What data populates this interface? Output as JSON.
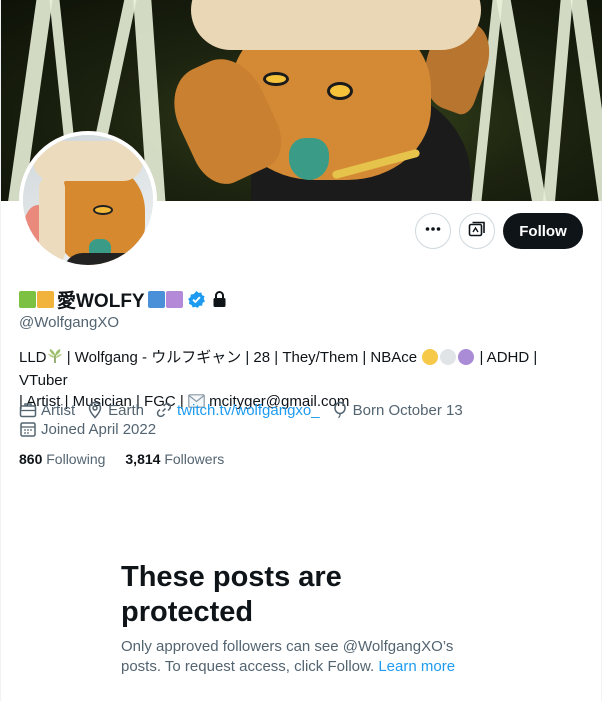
{
  "profile": {
    "display_name": "愛WOLFY",
    "handle": "@WolfgangXO",
    "bio_line1_a": "LLD",
    "bio_line1_b": " | Wolfgang - ウルフギャン | 28 | They/Them | NBAce ",
    "bio_line1_c": " | ADHD | VTuber",
    "bio_line2_a": "| Artist | Musician | FGC | ",
    "bio_line2_b": " mcityger@gmail.com",
    "name_emoji_left_colors": [
      "#7cc142",
      "#f2b33d"
    ],
    "name_emoji_right_colors": [
      "#4a90d9",
      "#b48ad8"
    ],
    "nbace_dot_colors": [
      "#f7c948",
      "#e1e4e6",
      "#a98bd6"
    ]
  },
  "meta": {
    "profession": "Artist",
    "location": "Earth",
    "website": "twitch.tv/wolfgangxo_",
    "born": "Born October 13",
    "joined": "Joined April 2022"
  },
  "stats": {
    "following_count": "860",
    "following_label": "Following",
    "followers_count": "3,814",
    "followers_label": "Followers"
  },
  "actions": {
    "follow_label": "Follow",
    "more_icon": "more-icon",
    "subscribe_icon": "subscribe-icon"
  },
  "protected": {
    "title": "These posts are protected",
    "desc_before": "Only approved followers can see @WolfgangXO’s posts. To request access, click Follow. ",
    "learn_more": "Learn more"
  },
  "colors": {
    "accent": "#1d9bf0",
    "follow_bg": "#0f1419",
    "verified": "#1d9bf0",
    "banner_stripe": "#e8f0d8"
  }
}
